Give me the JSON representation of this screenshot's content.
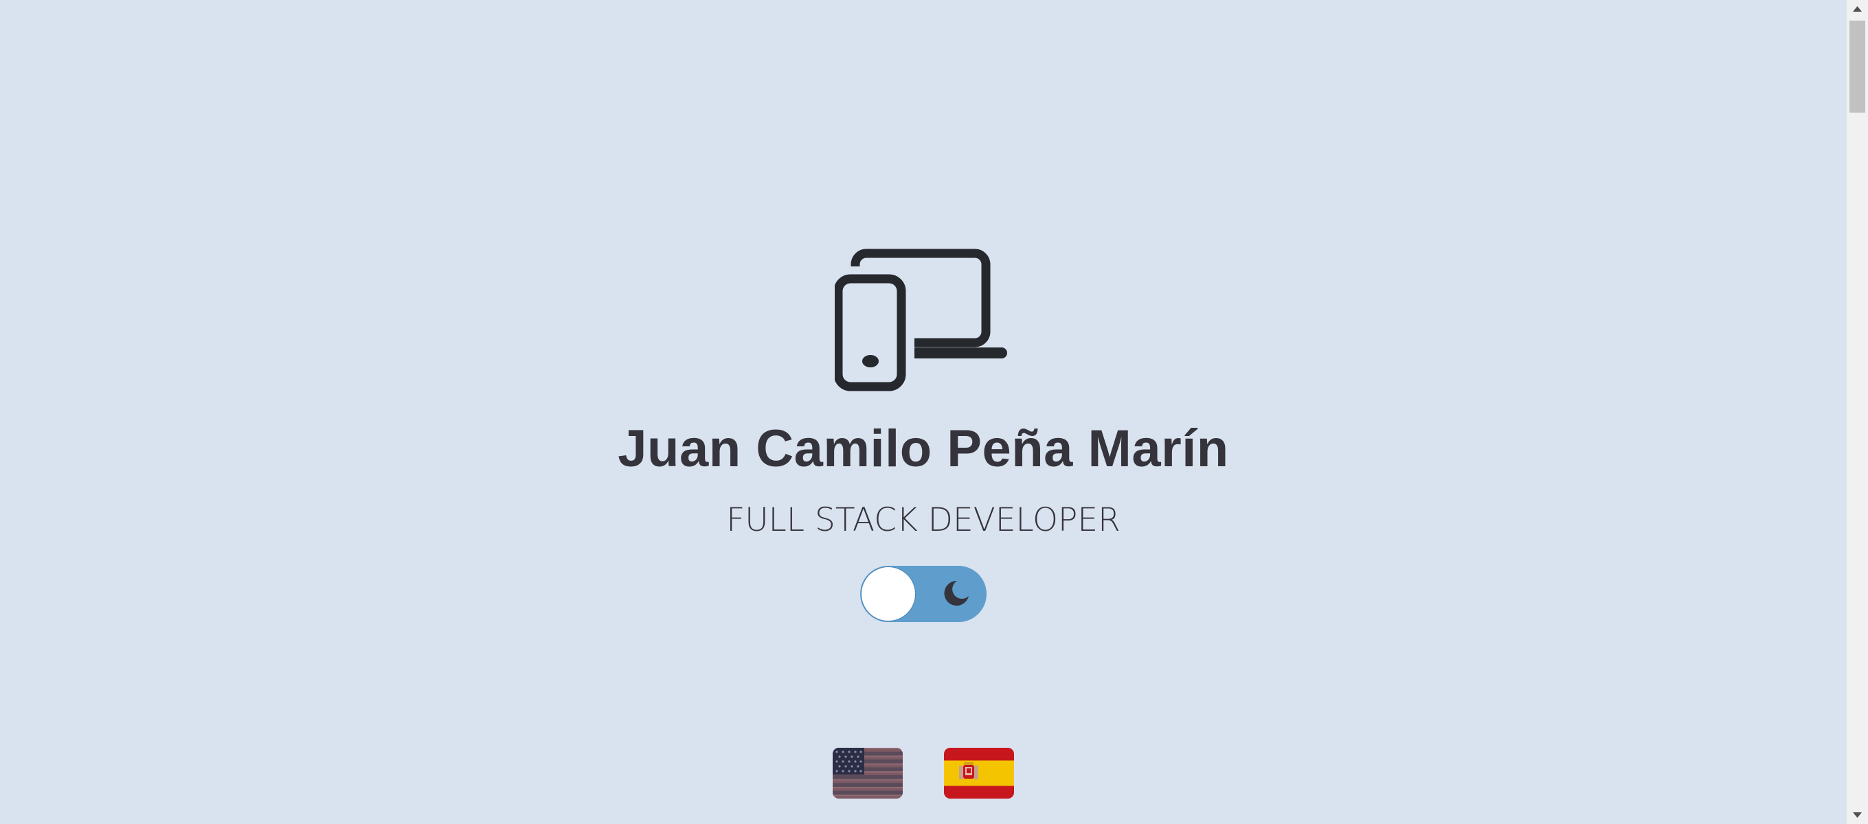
{
  "header": {
    "icon": "devices-icon",
    "name": "Juan Camilo Peña Marín",
    "role": "FULL STACK DEVELOPER"
  },
  "theme_toggle": {
    "icon": "moon-icon",
    "state": "light",
    "colors": {
      "track": "#5f9dcc",
      "knob": "#ffffff"
    }
  },
  "languages": [
    {
      "code": "en",
      "icon": "us-flag-icon"
    },
    {
      "code": "es",
      "icon": "spain-flag-icon"
    }
  ],
  "colors": {
    "background": "#d9e3ef",
    "text": "#35333b"
  }
}
